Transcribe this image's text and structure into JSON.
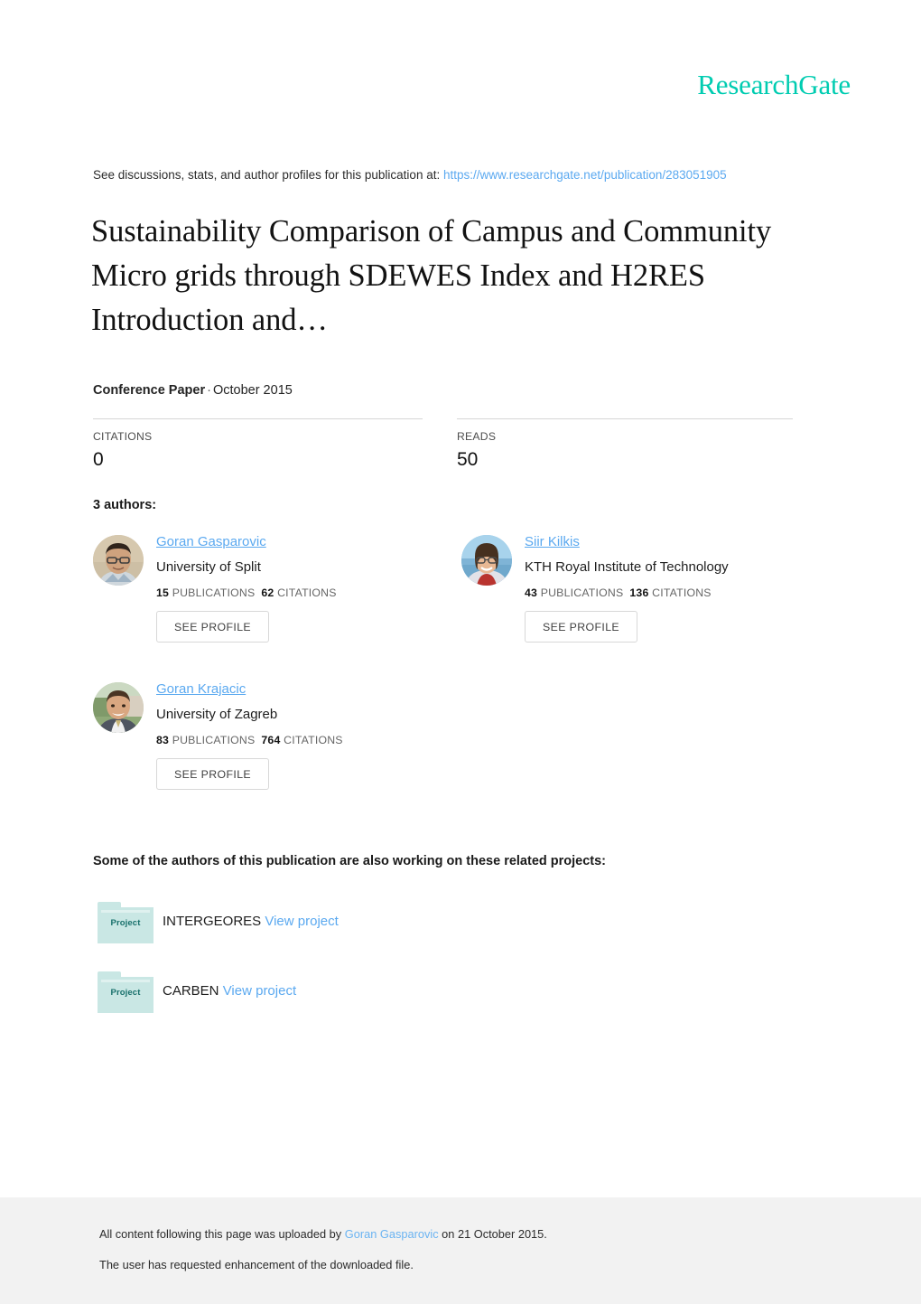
{
  "brand": {
    "logo_text": "ResearchGate",
    "accent_color": "#00ccb1",
    "link_color": "#5ba9f0"
  },
  "header": {
    "discussion_prefix": "See discussions, stats, and author profiles for this publication at:",
    "publication_url": "https://www.researchgate.net/publication/283051905"
  },
  "publication": {
    "title": "Sustainability Comparison of Campus and Community Micro grids through SDEWES Index and H2RES Introduction and…",
    "type": "Conference Paper",
    "separator": "·",
    "date": "October 2015"
  },
  "metrics": [
    {
      "label": "CITATIONS",
      "value": "0"
    },
    {
      "label": "READS",
      "value": "50"
    }
  ],
  "authors_section": {
    "heading": "3 authors:",
    "publications_label": "PUBLICATIONS",
    "citations_label": "CITATIONS",
    "see_profile_label": "SEE PROFILE",
    "authors": [
      {
        "name": "Goran Gasparovic",
        "affiliation": "University of Split",
        "publications": "15",
        "citations": "62"
      },
      {
        "name": "Siir Kilkis",
        "affiliation": "KTH Royal Institute of Technology",
        "publications": "43",
        "citations": "136"
      },
      {
        "name": "Goran Krajacic",
        "affiliation": "University of Zagreb",
        "publications": "83",
        "citations": "764"
      }
    ]
  },
  "projects_section": {
    "heading": "Some of the authors of this publication are also working on these related projects:",
    "folder_icon_label": "Project",
    "view_project_label": "View project",
    "projects": [
      {
        "name": "INTERGEORES"
      },
      {
        "name": "CARBEN"
      }
    ]
  },
  "footer": {
    "upload_prefix": "All content following this page was uploaded by",
    "uploader": "Goran Gasparovic",
    "upload_suffix": "on 21 October 2015.",
    "enhancement_note": "The user has requested enhancement of the downloaded file."
  }
}
